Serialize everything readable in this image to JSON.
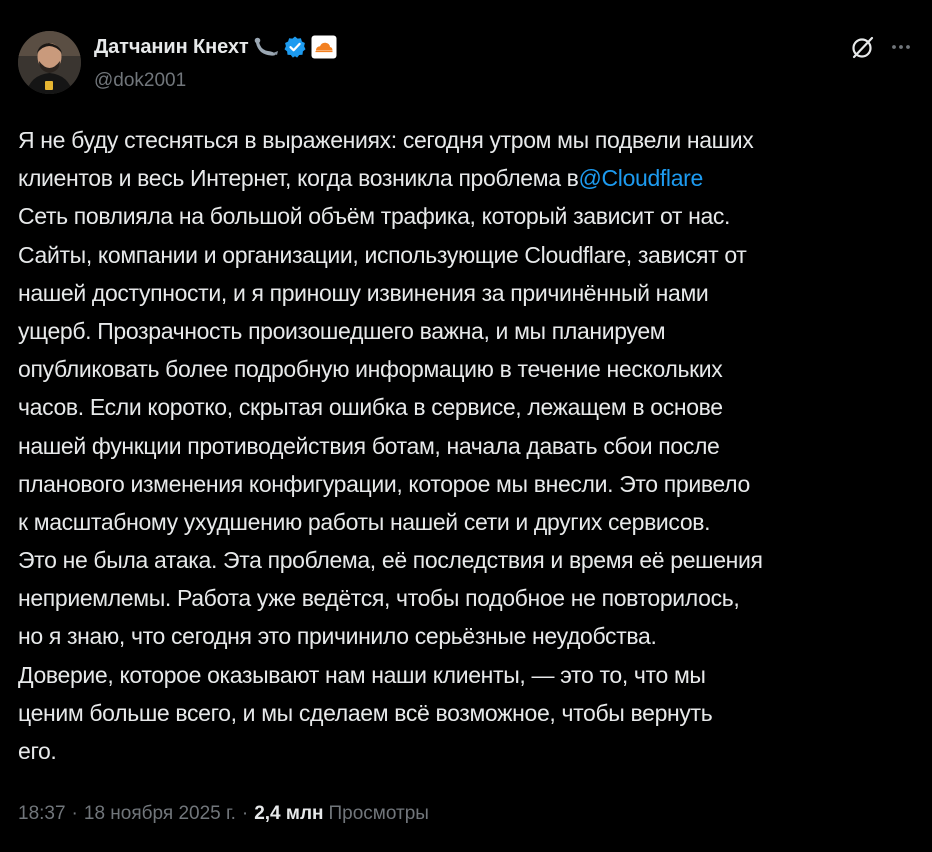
{
  "author": {
    "display_name": "Датчанин Кнехт",
    "handle": "@dok2001",
    "verified": true,
    "avatar_icon": "avatar-photo",
    "badge_emoji_icon": "seal-emoji-icon",
    "affiliation_icon": "cloudflare-logo-icon"
  },
  "actions": {
    "grok_icon": "grok-icon",
    "more_icon": "more-icon"
  },
  "tweet": {
    "lines": [
      {
        "text": "Я не буду стесняться в выражениях: сегодня утром мы подвели наших"
      },
      {
        "text": "клиентов и весь Интернет, когда возникла проблема в",
        "mention": "@Cloudflare"
      },
      {
        "text": "Сеть повлияла на большой объём трафика, который зависит от нас."
      },
      {
        "text": "Сайты, компании и организации, использующие Cloudflare, зависят от"
      },
      {
        "text": "нашей доступности, и я приношу извинения за причинённый нами"
      },
      {
        "text": "ущерб. Прозрачность произошедшего важна, и мы планируем"
      },
      {
        "text": "опубликовать более подробную информацию в течение нескольких"
      },
      {
        "text": "часов. Если коротко, скрытая ошибка в сервисе, лежащем в основе"
      },
      {
        "text": "нашей функции противодействия ботам, начала давать сбои после"
      },
      {
        "text": "планового изменения конфигурации, которое мы внесли. Это привело"
      },
      {
        "text": "к масштабному ухудшению работы нашей сети и других сервисов."
      },
      {
        "text": "Это не была атака. Эта проблема, её последствия и время её решения"
      },
      {
        "text": "неприемлемы. Работа уже ведётся, чтобы подобное не повторилось,"
      },
      {
        "text": "но я знаю, что сегодня это причинило серьёзные неудобства."
      },
      {
        "text": "Доверие, которое оказывают нам наши клиенты, — это то, что мы"
      },
      {
        "text": "ценим больше всего, и мы сделаем всё возможное, чтобы вернуть"
      },
      {
        "text": "его."
      }
    ]
  },
  "meta": {
    "time": "18:37",
    "date": "18 ноября 2025 г.",
    "separator": "·",
    "views_count": "2,4 млн",
    "views_label": "Просмотры"
  },
  "colors": {
    "background": "#000000",
    "text": "#e7e9ea",
    "secondary": "#71767b",
    "link": "#1d9bf0",
    "cloudflare_orange": "#f38020"
  }
}
